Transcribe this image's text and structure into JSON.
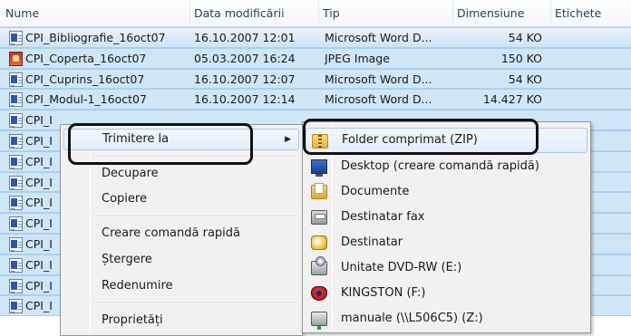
{
  "columns": {
    "name": "Nume",
    "date": "Data modificării",
    "type": "Tip",
    "size": "Dimensiune",
    "tags": "Etichete"
  },
  "files": [
    {
      "name": "CPI_Bibliografie_16oct07",
      "date": "16.10.2007 12:01",
      "type": "Microsoft Word D...",
      "size": "54 KO",
      "icon": "word-document-icon"
    },
    {
      "name": "CPI_Coperta_16oct07",
      "date": "05.03.2007 16:24",
      "type": "JPEG Image",
      "size": "150 KO",
      "icon": "jpeg-image-icon"
    },
    {
      "name": "CPI_Cuprins_16oct07",
      "date": "16.10.2007 12:07",
      "type": "Microsoft Word D...",
      "size": "54 KO",
      "icon": "word-document-icon"
    },
    {
      "name": "CPI_Modul-1_16oct07",
      "date": "16.10.2007 12:14",
      "type": "Microsoft Word D...",
      "size": "14.427 KO",
      "icon": "word-document-icon"
    },
    {
      "name": "CPI_I",
      "icon": "word-document-icon"
    },
    {
      "name": "CPI_I",
      "icon": "word-document-icon"
    },
    {
      "name": "CPI_I",
      "icon": "word-document-icon"
    },
    {
      "name": "CPI_I",
      "icon": "word-document-icon"
    },
    {
      "name": "CPI_I",
      "icon": "word-document-icon"
    },
    {
      "name": "CPI_I",
      "icon": "word-document-icon"
    },
    {
      "name": "CPI_I",
      "icon": "word-document-icon"
    },
    {
      "name": "CPI_I",
      "icon": "word-document-icon"
    },
    {
      "name": "CPI_I",
      "icon": "word-document-icon"
    },
    {
      "name": "CPI_I",
      "icon": "word-document-icon"
    }
  ],
  "context_menu": {
    "send_to": "Trimitere la",
    "cut": "Decupare",
    "copy": "Copiere",
    "create_shortcut": "Creare comandă rapidă",
    "delete": "Ștergere",
    "rename": "Redenumire",
    "properties": "Proprietăți"
  },
  "send_to_menu": [
    {
      "label": "Folder comprimat (ZIP)",
      "icon": "zip-folder-icon"
    },
    {
      "label": "Desktop (creare comandă rapidă)",
      "icon": "desktop-icon"
    },
    {
      "label": "Documente",
      "icon": "documents-folder-icon"
    },
    {
      "label": "Destinatar fax",
      "icon": "fax-icon"
    },
    {
      "label": "Destinatar",
      "icon": "mail-recipient-icon"
    },
    {
      "label": "Unitate DVD-RW (E:)",
      "icon": "dvd-drive-icon"
    },
    {
      "label": "KINGSTON (F:)",
      "icon": "usb-drive-icon"
    },
    {
      "label": "manuale (\\\\L506C5) (Z:)",
      "icon": "network-drive-icon"
    }
  ],
  "colors": {
    "selection": "#cfe6f7",
    "menu_background": "#f1f1f1",
    "highlight_border": "#a8c8ec",
    "annotation": "#111111"
  }
}
